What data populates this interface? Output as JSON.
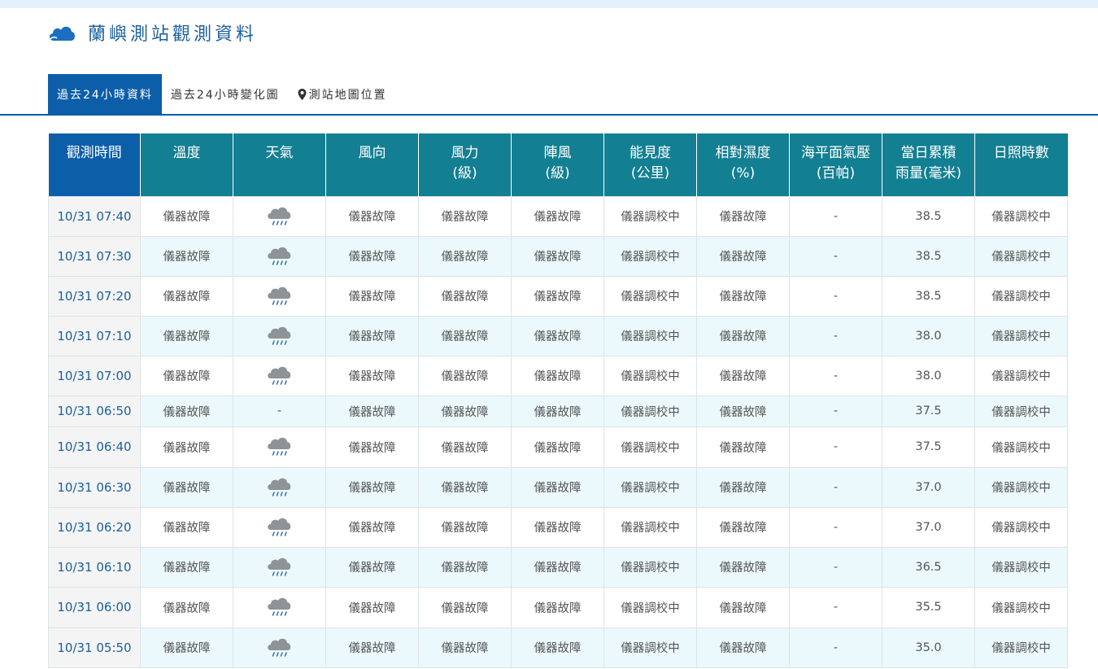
{
  "page": {
    "title": "蘭嶼測站觀測資料",
    "tabs": [
      {
        "label": "過去24小時資料"
      },
      {
        "label": "過去24小時變化圖"
      },
      {
        "label": "測站地圖位置"
      }
    ],
    "active_tab": 0,
    "colors": {
      "brand": "#0d5ea8",
      "header_teal": "#137f92",
      "row_alt": "#ecf9fc"
    }
  },
  "table": {
    "headers": [
      [
        "觀測時間"
      ],
      [
        "溫度"
      ],
      [
        "天氣"
      ],
      [
        "風向"
      ],
      [
        "風力",
        "(級)"
      ],
      [
        "陣風",
        "(級)"
      ],
      [
        "能見度",
        "(公里)"
      ],
      [
        "相對濕度",
        "(%)"
      ],
      [
        "海平面氣壓",
        "(百帕)"
      ],
      [
        "當日累積",
        "雨量(毫米)"
      ],
      [
        "日照時數"
      ]
    ],
    "rows": [
      {
        "time": "10/31 07:40",
        "temp": "儀器故障",
        "weather": "rain-cloud-icon",
        "wind_dir": "儀器故障",
        "wind_force": "儀器故障",
        "gust": "儀器故障",
        "visibility": "儀器調校中",
        "humidity": "儀器故障",
        "pressure": "-",
        "rain": "38.5",
        "sunshine": "儀器調校中"
      },
      {
        "time": "10/31 07:30",
        "temp": "儀器故障",
        "weather": "rain-cloud-icon",
        "wind_dir": "儀器故障",
        "wind_force": "儀器故障",
        "gust": "儀器故障",
        "visibility": "儀器調校中",
        "humidity": "儀器故障",
        "pressure": "-",
        "rain": "38.5",
        "sunshine": "儀器調校中"
      },
      {
        "time": "10/31 07:20",
        "temp": "儀器故障",
        "weather": "rain-cloud-icon",
        "wind_dir": "儀器故障",
        "wind_force": "儀器故障",
        "gust": "儀器故障",
        "visibility": "儀器調校中",
        "humidity": "儀器故障",
        "pressure": "-",
        "rain": "38.5",
        "sunshine": "儀器調校中"
      },
      {
        "time": "10/31 07:10",
        "temp": "儀器故障",
        "weather": "rain-cloud-icon",
        "wind_dir": "儀器故障",
        "wind_force": "儀器故障",
        "gust": "儀器故障",
        "visibility": "儀器調校中",
        "humidity": "儀器故障",
        "pressure": "-",
        "rain": "38.0",
        "sunshine": "儀器調校中"
      },
      {
        "time": "10/31 07:00",
        "temp": "儀器故障",
        "weather": "rain-cloud-icon",
        "wind_dir": "儀器故障",
        "wind_force": "儀器故障",
        "gust": "儀器故障",
        "visibility": "儀器調校中",
        "humidity": "儀器故障",
        "pressure": "-",
        "rain": "38.0",
        "sunshine": "儀器調校中"
      },
      {
        "time": "10/31 06:50",
        "temp": "儀器故障",
        "weather": "-",
        "wind_dir": "儀器故障",
        "wind_force": "儀器故障",
        "gust": "儀器故障",
        "visibility": "儀器調校中",
        "humidity": "儀器故障",
        "pressure": "-",
        "rain": "37.5",
        "sunshine": "儀器調校中"
      },
      {
        "time": "10/31 06:40",
        "temp": "儀器故障",
        "weather": "rain-cloud-icon",
        "wind_dir": "儀器故障",
        "wind_force": "儀器故障",
        "gust": "儀器故障",
        "visibility": "儀器調校中",
        "humidity": "儀器故障",
        "pressure": "-",
        "rain": "37.5",
        "sunshine": "儀器調校中"
      },
      {
        "time": "10/31 06:30",
        "temp": "儀器故障",
        "weather": "rain-cloud-icon",
        "wind_dir": "儀器故障",
        "wind_force": "儀器故障",
        "gust": "儀器故障",
        "visibility": "儀器調校中",
        "humidity": "儀器故障",
        "pressure": "-",
        "rain": "37.0",
        "sunshine": "儀器調校中"
      },
      {
        "time": "10/31 06:20",
        "temp": "儀器故障",
        "weather": "rain-cloud-icon",
        "wind_dir": "儀器故障",
        "wind_force": "儀器故障",
        "gust": "儀器故障",
        "visibility": "儀器調校中",
        "humidity": "儀器故障",
        "pressure": "-",
        "rain": "37.0",
        "sunshine": "儀器調校中"
      },
      {
        "time": "10/31 06:10",
        "temp": "儀器故障",
        "weather": "rain-cloud-icon",
        "wind_dir": "儀器故障",
        "wind_force": "儀器故障",
        "gust": "儀器故障",
        "visibility": "儀器調校中",
        "humidity": "儀器故障",
        "pressure": "-",
        "rain": "36.5",
        "sunshine": "儀器調校中"
      },
      {
        "time": "10/31 06:00",
        "temp": "儀器故障",
        "weather": "rain-cloud-icon",
        "wind_dir": "儀器故障",
        "wind_force": "儀器故障",
        "gust": "儀器故障",
        "visibility": "儀器調校中",
        "humidity": "儀器故障",
        "pressure": "-",
        "rain": "35.5",
        "sunshine": "儀器調校中"
      },
      {
        "time": "10/31 05:50",
        "temp": "儀器故障",
        "weather": "rain-cloud-icon",
        "wind_dir": "儀器故障",
        "wind_force": "儀器故障",
        "gust": "儀器故障",
        "visibility": "儀器調校中",
        "humidity": "儀器故障",
        "pressure": "-",
        "rain": "35.0",
        "sunshine": "儀器調校中"
      }
    ]
  }
}
